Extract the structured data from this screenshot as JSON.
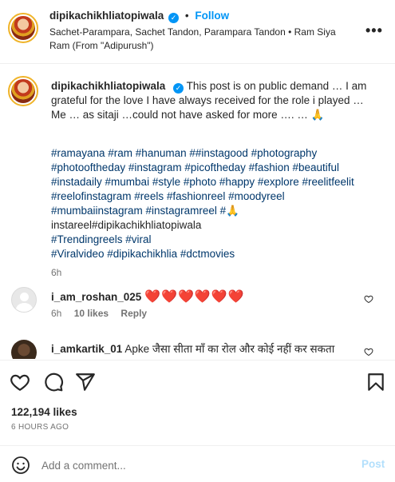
{
  "header": {
    "username": "dipikachikhliatopiwala",
    "verified_glyph": "✓",
    "dot": "•",
    "follow_label": "Follow",
    "audio_text": "Sachet-Parampara, Sachet Tandon, Parampara Tandon • Ram Siya Ram (From \"Adipurush\")",
    "more_label": "•••"
  },
  "caption": {
    "username": "dipikachikhliatopiwala",
    "text": "This post is on public demand … I am grateful for the love I have always received for the role i played … Me … as sitaji …could not have asked for more …. … 🙏",
    "hashtag_lines": [
      "#ramayana #ram #hanuman ##instagood #photography",
      "#photooftheday #instagram #picoftheday #fashion #beautiful",
      "#instadaily #mumbai #style #photo #happy #explore #reelitfeelit",
      "#reelofinstagram #reels #fashionreel #moodyreel",
      "#mumbaiinstagram #instagramreel #🙏",
      "instareel#dipikachikhliatopiwala",
      "#Trendingreels #viral",
      "#Viralvideo #dipikachikhlia #dctmovies"
    ],
    "time": "6h"
  },
  "comments": [
    {
      "username": "i_am_roshan_025",
      "text": "❤️❤️❤️❤️❤️❤️",
      "time": "6h",
      "likes": "10 likes",
      "reply": "Reply"
    },
    {
      "username": "i_amkartik_01",
      "text": "Apke जैसा सीता माँ का रोल और कोई नहीं कर सकता"
    }
  ],
  "actions": {
    "icons": [
      "heart-icon",
      "comment-icon",
      "share-icon",
      "bookmark-icon"
    ],
    "likes": "122,194 likes",
    "time_ago": "6 HOURS AGO"
  },
  "comment_bar": {
    "placeholder": "Add a comment...",
    "post_label": "Post"
  },
  "colors": {
    "accent": "#0095f6",
    "hashtag": "#00376b",
    "heart": "#ed1d3a",
    "post_disabled": "#b2dffc"
  }
}
